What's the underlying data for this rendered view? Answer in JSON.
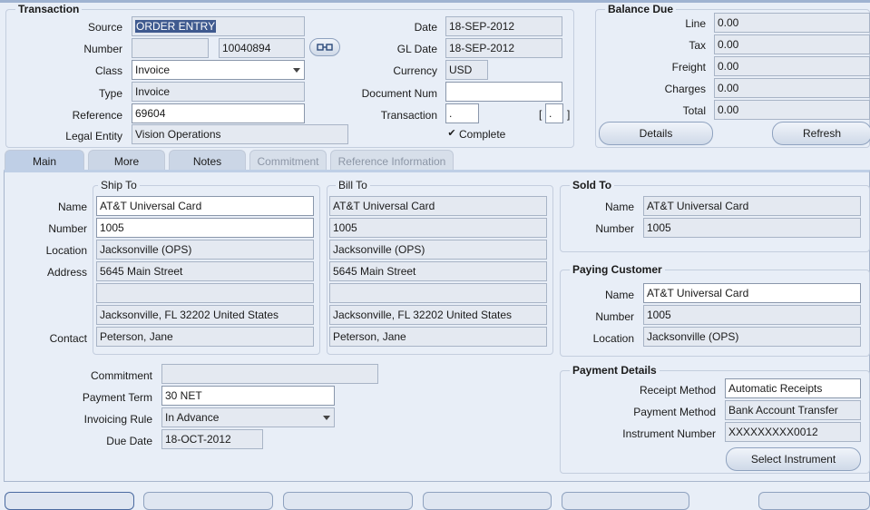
{
  "transaction": {
    "title": "Transaction",
    "source_label": "Source",
    "source_value": "ORDER ENTRY",
    "number_label": "Number",
    "number_prefix": "",
    "number_value": "10040894",
    "class_label": "Class",
    "class_value": "Invoice",
    "type_label": "Type",
    "type_value": "Invoice",
    "reference_label": "Reference",
    "reference_value": "69604",
    "legal_entity_label": "Legal Entity",
    "legal_entity_value": "Vision Operations",
    "date_label": "Date",
    "date_value": "18-SEP-2012",
    "gl_date_label": "GL Date",
    "gl_date_value": "18-SEP-2012",
    "currency_label": "Currency",
    "currency_value": "USD",
    "document_num_label": "Document Num",
    "document_num_value": "",
    "transaction_flag_label": "Transaction",
    "transaction_flag_value": ".",
    "bracket_value": ".",
    "complete_label": "Complete",
    "complete_checked": "✔"
  },
  "balance_due": {
    "title": "Balance Due",
    "line_label": "Line",
    "line_value": "0.00",
    "tax_label": "Tax",
    "tax_value": "0.00",
    "freight_label": "Freight",
    "freight_value": "0.00",
    "charges_label": "Charges",
    "charges_value": "0.00",
    "total_label": "Total",
    "total_value": "0.00",
    "details_button": "Details",
    "refresh_button": "Refresh"
  },
  "tabs": [
    {
      "label": "Main",
      "state": "active"
    },
    {
      "label": "More",
      "state": "enabled"
    },
    {
      "label": "Notes",
      "state": "enabled"
    },
    {
      "label": "Commitment",
      "state": "disabled"
    },
    {
      "label": "Reference Information",
      "state": "disabled"
    }
  ],
  "ship_to": {
    "title": "Ship To",
    "name": "AT&T Universal Card",
    "number": "1005",
    "location": "Jacksonville (OPS)",
    "address1": "5645 Main Street",
    "address2": "",
    "address3": "Jacksonville, FL 32202 United States",
    "contact": "Peterson, Jane"
  },
  "bill_to": {
    "title": "Bill To",
    "name": "AT&T Universal Card",
    "number": "1005",
    "location": "Jacksonville (OPS)",
    "address1": "5645 Main Street",
    "address2": "",
    "address3": "Jacksonville, FL 32202 United States",
    "contact": "Peterson, Jane"
  },
  "row_labels": {
    "name": "Name",
    "number": "Number",
    "location": "Location",
    "address": "Address",
    "contact": "Contact"
  },
  "terms": {
    "commitment_label": "Commitment",
    "commitment_value": "",
    "payment_term_label": "Payment Term",
    "payment_term_value": "30 NET",
    "invoicing_rule_label": "Invoicing Rule",
    "invoicing_rule_value": "In Advance",
    "due_date_label": "Due Date",
    "due_date_value": "18-OCT-2012"
  },
  "sold_to": {
    "title": "Sold To",
    "name_label": "Name",
    "name_value": "AT&T Universal Card",
    "number_label": "Number",
    "number_value": "1005"
  },
  "paying_customer": {
    "title": "Paying Customer",
    "name_label": "Name",
    "name_value": "AT&T Universal Card",
    "number_label": "Number",
    "number_value": "1005",
    "location_label": "Location",
    "location_value": "Jacksonville (OPS)"
  },
  "payment_details": {
    "title": "Payment Details",
    "receipt_method_label": "Receipt Method",
    "receipt_method_value": "Automatic Receipts",
    "payment_method_label": "Payment Method",
    "payment_method_value": "Bank Account Transfer",
    "instrument_number_label": "Instrument Number",
    "instrument_number_value": "XXXXXXXXX0012",
    "select_instrument_button": "Select Instrument"
  },
  "icons": {
    "flashlight": "flashlight-icon",
    "checkmark": "checkmark-icon",
    "dropdown": "chevron-down-icon"
  },
  "colors": {
    "background": "#e8eef7",
    "readonly_field": "#e4e9f1",
    "editable_field": "#ffffff",
    "selection": "#3f5a8f",
    "tab_active": "#bfcfe6"
  }
}
